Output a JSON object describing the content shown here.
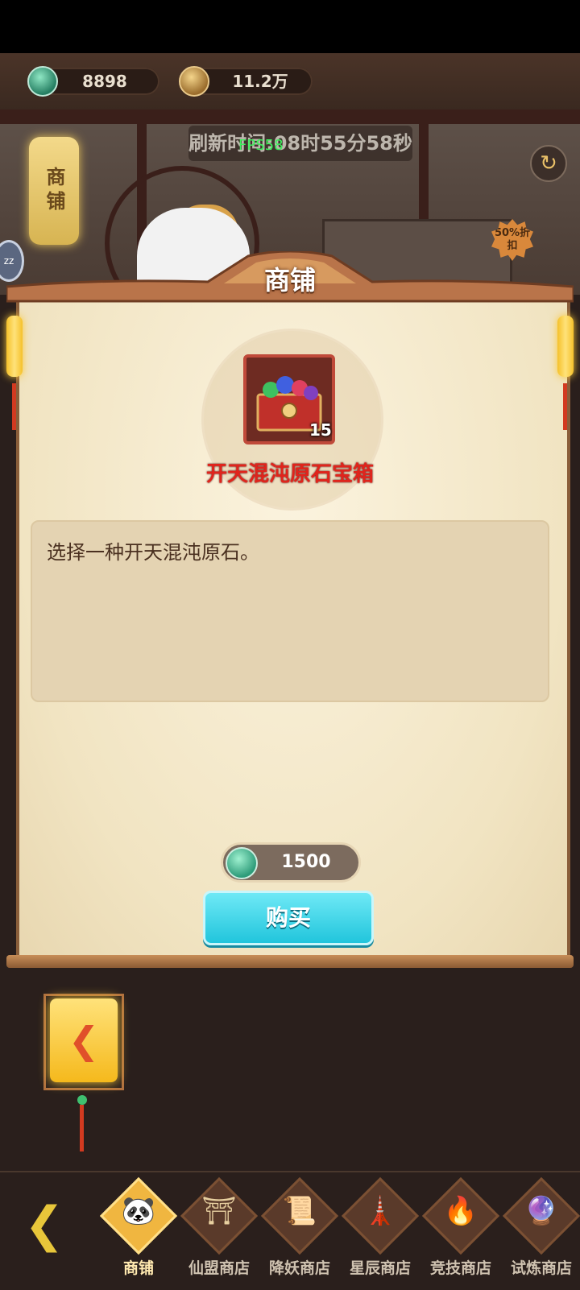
{
  "currency": {
    "jade_amount": "8898",
    "coin_amount": "11.2万"
  },
  "header": {
    "refresh_label": "刷新时间:08时55分58秒",
    "fps": "FPS58",
    "shop_lantern": "商铺",
    "discount_badge": "50%折扣",
    "sleep_badge": "zz"
  },
  "panel": {
    "title": "商铺",
    "item": {
      "name": "开天混沌原石宝箱",
      "count": "15",
      "description": "选择一种开天混沌原石。"
    },
    "price": "1500",
    "buy_label": "购买"
  },
  "nav": {
    "items": [
      {
        "label": "商铺",
        "glyph": "🐼",
        "active": true
      },
      {
        "label": "仙盟商店",
        "glyph": "⛩",
        "active": false
      },
      {
        "label": "降妖商店",
        "glyph": "📜",
        "active": false
      },
      {
        "label": "星辰商店",
        "glyph": "🗼",
        "active": false
      },
      {
        "label": "竞技商店",
        "glyph": "🔥",
        "active": false
      },
      {
        "label": "试炼商店",
        "glyph": "🔮",
        "active": false
      }
    ]
  },
  "colors": {
    "accent_cyan": "#21c5dc",
    "item_name_red": "#e0241c",
    "lantern_gold": "#f5c12b"
  }
}
